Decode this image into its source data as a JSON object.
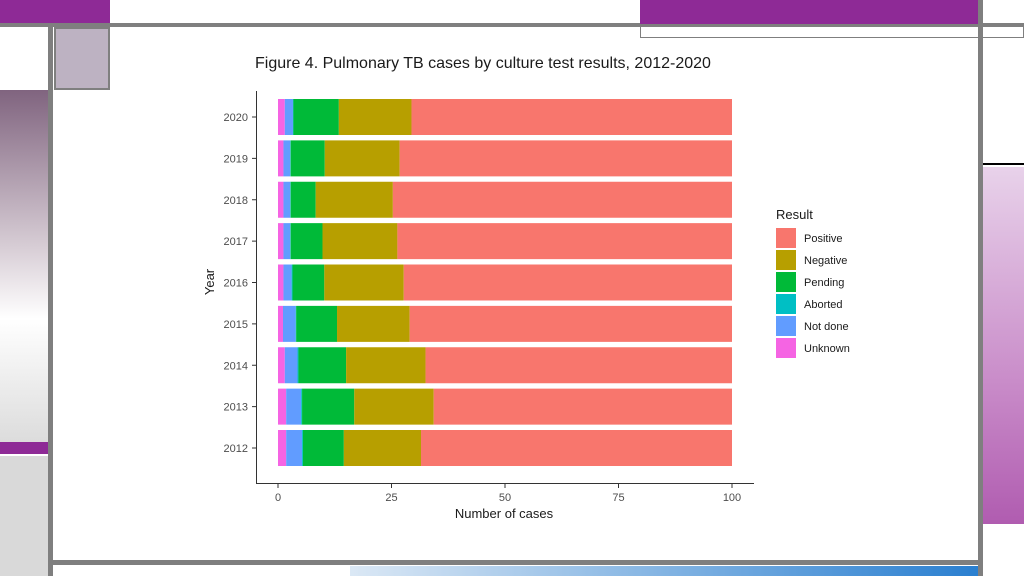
{
  "chart_data": {
    "type": "bar",
    "orientation": "horizontal",
    "stacked": true,
    "title": "Figure 4. Pulmonary TB cases by culture test results, 2012-2020",
    "xlabel": "Number of cases",
    "ylabel": "Year",
    "xlim": [
      0,
      100
    ],
    "xticks": [
      0,
      25,
      50,
      75,
      100
    ],
    "categories": [
      "2012",
      "2013",
      "2014",
      "2015",
      "2016",
      "2017",
      "2018",
      "2019",
      "2020"
    ],
    "legend_title": "Result",
    "legend_position": "right",
    "grid": false,
    "series": [
      {
        "name": "Unknown",
        "color": "#F564E3",
        "values": [
          1.8,
          1.8,
          1.5,
          1.1,
          1.2,
          1.2,
          1.2,
          1.2,
          1.5
        ]
      },
      {
        "name": "Not done",
        "color": "#619CFF",
        "values": [
          3.5,
          3.3,
          2.8,
          2.8,
          1.8,
          1.5,
          1.5,
          1.5,
          1.8
        ]
      },
      {
        "name": "Aborted",
        "color": "#00BFC4",
        "values": [
          0.2,
          0.2,
          0.2,
          0.1,
          0.2,
          0.1,
          0.1,
          0.1,
          0.1
        ]
      },
      {
        "name": "Pending",
        "color": "#00BA38",
        "values": [
          9,
          11.5,
          10.5,
          9,
          7,
          7,
          5.5,
          7.5,
          10
        ]
      },
      {
        "name": "Negative",
        "color": "#B79F00",
        "values": [
          17,
          17.5,
          17.5,
          16,
          17.5,
          16.5,
          17,
          16.5,
          16
        ]
      },
      {
        "name": "Positive",
        "color": "#F8766D",
        "values": [
          68.5,
          65.7,
          67.5,
          71,
          72.3,
          73.7,
          74.7,
          73.2,
          70.6
        ]
      }
    ],
    "legend_order": [
      "Positive",
      "Negative",
      "Pending",
      "Aborted",
      "Not done",
      "Unknown"
    ]
  }
}
